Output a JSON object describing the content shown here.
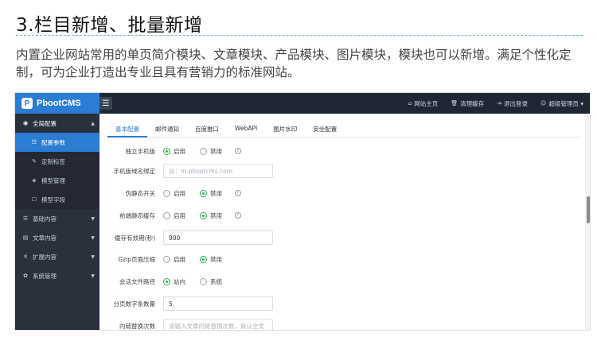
{
  "caption": {
    "title": "3.栏目新增、批量新增",
    "description": "内置企业网站常用的单页简介模块、文章模块、产品模块、图片模块，模块也可以新增。满足个性化定制，可为企业打造出专业且具有营销力的标准网站。"
  },
  "app": {
    "logo": "PbootCMS",
    "logo_mark": "P",
    "top_links": [
      {
        "label": "网站主页",
        "icon": "home-icon",
        "glyph": "⌂"
      },
      {
        "label": "清理缓存",
        "icon": "trash-icon",
        "glyph": "🗑"
      },
      {
        "label": "退出登录",
        "icon": "logout-icon",
        "glyph": "⇥"
      },
      {
        "label": "超级管理员 ▾",
        "icon": "user-icon",
        "glyph": "☺"
      }
    ],
    "sidebar": [
      {
        "label": "全局配置",
        "icon": "globe-icon",
        "glyph": "◉",
        "arrow": "▲"
      },
      {
        "label": "配置参数",
        "icon": "sliders-icon",
        "glyph": "☷"
      },
      {
        "label": "定制标签",
        "icon": "wrench-icon",
        "glyph": "✎"
      },
      {
        "label": "模型管理",
        "icon": "cube-icon",
        "glyph": "◈"
      },
      {
        "label": "模型字段",
        "icon": "edit-icon",
        "glyph": "☐"
      },
      {
        "label": "基础内容",
        "icon": "list-icon",
        "glyph": "☰",
        "arrow": "▼"
      },
      {
        "label": "文章内容",
        "icon": "file-icon",
        "glyph": "▤",
        "arrow": "▼"
      },
      {
        "label": "扩展内容",
        "icon": "expand-icon",
        "glyph": "✕",
        "arrow": "▼"
      },
      {
        "label": "系统管理",
        "icon": "gear-icon",
        "glyph": "✿",
        "arrow": "▼"
      }
    ],
    "tabs": [
      "基本配置",
      "邮件通知",
      "百度推口",
      "WebAPI",
      "图片水印",
      "安全配置"
    ],
    "form": {
      "independent_mobile": {
        "label": "独立手机版",
        "opt1": "启用",
        "opt2": "禁用"
      },
      "mobile_domain": {
        "label": "手机版域名绑定",
        "placeholder": "如：m.pbootcms.com"
      },
      "pseudo_static": {
        "label": "伪静态开关",
        "opt1": "启用",
        "opt2": "禁用"
      },
      "frontend_cache": {
        "label": "前端静态缓存",
        "opt1": "启用",
        "opt2": "禁用"
      },
      "cache_period": {
        "label": "缓存有效期(秒)",
        "value": "900"
      },
      "gzip": {
        "label": "Gzip页面压缩",
        "opt1": "启用",
        "opt2": "禁用"
      },
      "session_path": {
        "label": "会话文件路径",
        "opt1": "站内",
        "opt2": "系统"
      },
      "page_count": {
        "label": "分页数字条数量",
        "value": "5"
      },
      "last_row": {
        "label": "内链替换次数",
        "placeholder": "请输入文章内链替换次数，默认全文"
      }
    },
    "info_glyph": "i"
  }
}
